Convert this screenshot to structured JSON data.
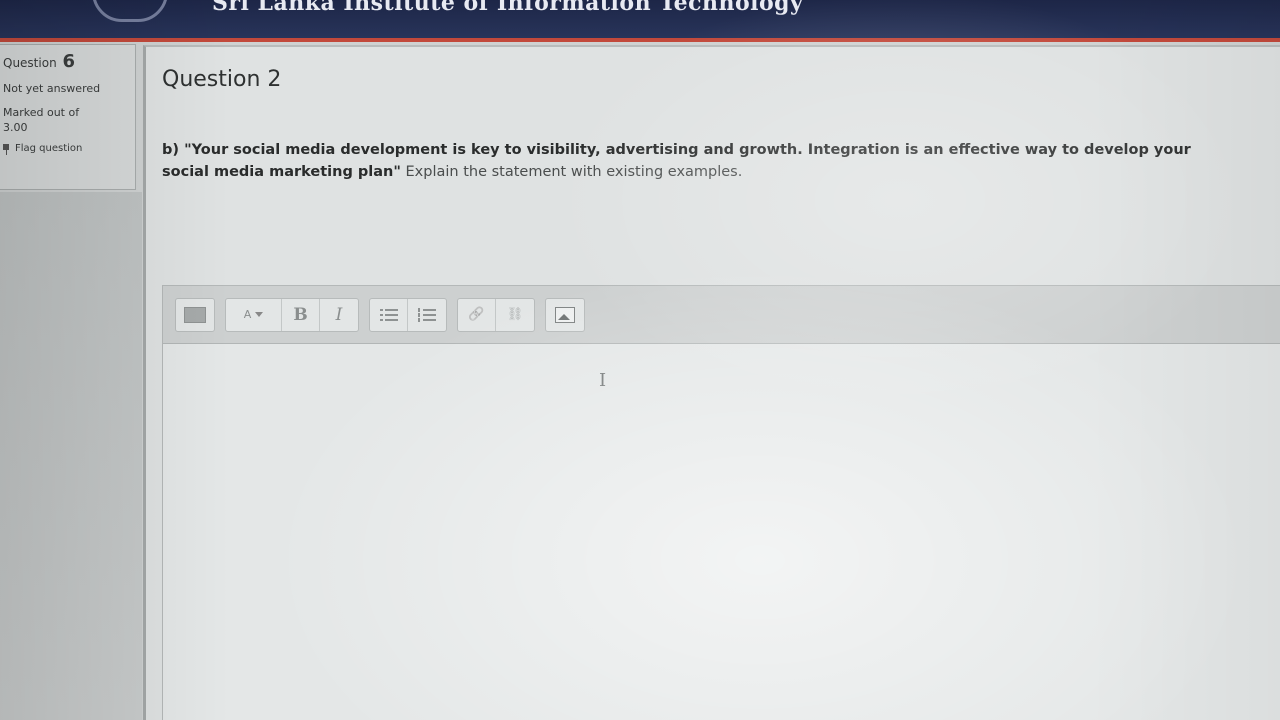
{
  "header": {
    "site_title": "Sri Lanka Institute of Information Technology"
  },
  "question_info": {
    "label": "Question",
    "number": "6",
    "state": "Not yet answered",
    "grade_label": "Marked out of",
    "grade_value": "3.00",
    "flag_label": "Flag question"
  },
  "question": {
    "heading": "Question 2",
    "prefix": "b) ",
    "quote": "\"Your social media development is key to visibility, advertising and growth. Integration is an effective way to develop your social media marketing plan\"",
    "instruction": " Explain the statement with existing examples."
  },
  "editor": {
    "toolbar": {
      "show_more": "▦",
      "paragraph_styles": "A",
      "bold": "B",
      "italic": "I",
      "unordered_list": "",
      "ordered_list": "",
      "link": "🔗",
      "unlink": "⛓",
      "insert_image": ""
    },
    "content": "",
    "cursor": "I"
  },
  "colors": {
    "header_bg": "#1d2647",
    "header_accent": "#c2493b",
    "page_bg": "#dfe2e2"
  }
}
